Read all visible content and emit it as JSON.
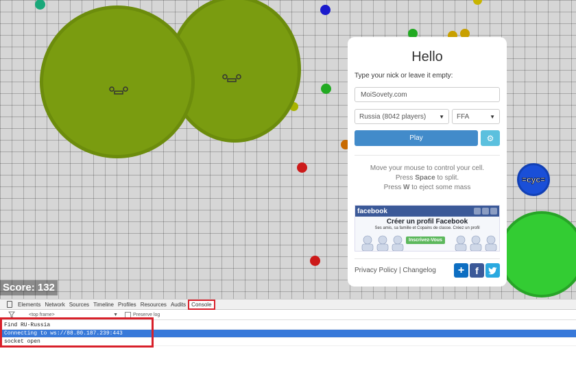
{
  "game": {
    "score_label": "Score: 132",
    "cyc_label": "=cyc="
  },
  "dialog": {
    "title": "Hello",
    "subtitle": "Type your nick or leave it empty:",
    "nick_value": "MoiSovety.com",
    "region_selected": "Russia (8042 players)",
    "mode_selected": "FFA",
    "play_label": "Play",
    "instructions": {
      "line1": "Move your mouse to control your cell.",
      "line2_pre": "Press ",
      "line2_key": "Space",
      "line2_post": " to split.",
      "line3_pre": "Press ",
      "line3_key": "W",
      "line3_post": " to eject some mass"
    },
    "ad": {
      "brand": "facebook",
      "headline": "Créer un profil Facebook",
      "text": "Ses amis, sa famille et Copains de classe. Créez un profil",
      "button": "Inscrivez-Vous"
    },
    "footer": {
      "privacy": "Privacy Policy",
      "separator": "|",
      "changelog": "Changelog"
    }
  },
  "devtools": {
    "tabs": [
      "Elements",
      "Network",
      "Sources",
      "Timeline",
      "Profiles",
      "Resources",
      "Audits",
      "Console"
    ],
    "active_tab": "Console",
    "frame_select": "<top frame>",
    "preserve_log": "Preserve log",
    "console_lines": [
      "Find RU-Russia",
      "Connecting to ws://88.80.187.239:443",
      "socket open"
    ]
  },
  "colors": {
    "cell_green": "#7a9c10",
    "virus_green": "#33cc33",
    "play_blue": "#428bca",
    "highlight_red": "#d8202a"
  }
}
